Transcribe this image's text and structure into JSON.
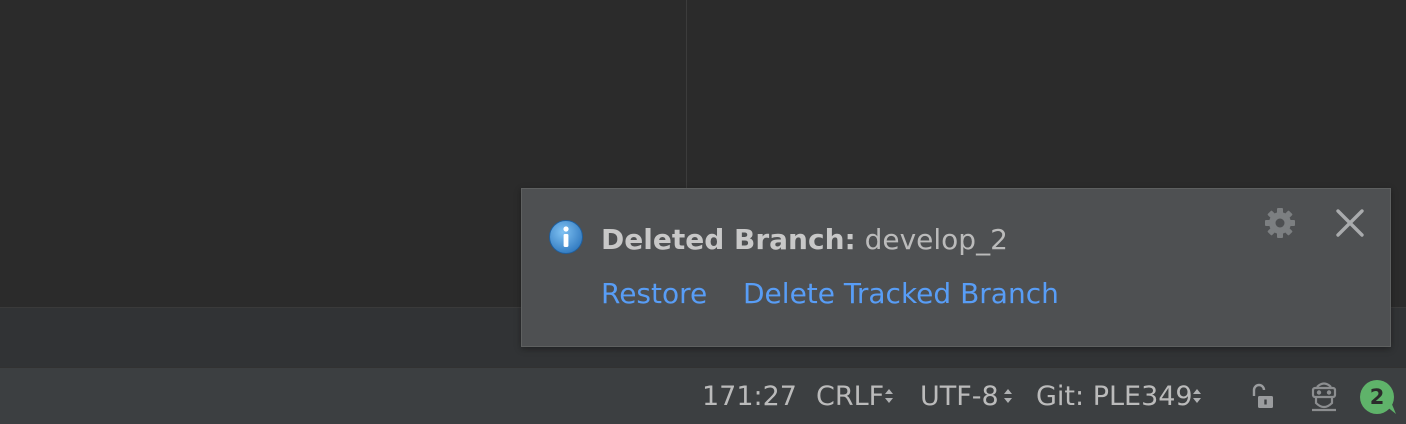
{
  "notification": {
    "title_bold": "Deleted Branch:",
    "title_value": " develop_2",
    "actions": [
      "Restore",
      "Delete Tracked Branch"
    ],
    "icons": {
      "info": "info-icon",
      "settings": "gear-icon",
      "close": "close-icon"
    }
  },
  "status_bar": {
    "position": "171:27",
    "line_separator": "CRLF",
    "encoding": "UTF-8",
    "vcs_branch": "Git: PLE349",
    "notifications_count": "2",
    "icons": [
      "lock-open-icon",
      "inspector-icon",
      "event-log-icon"
    ],
    "colors": {
      "badge": "#5fb36a",
      "link": "#589df6"
    }
  }
}
